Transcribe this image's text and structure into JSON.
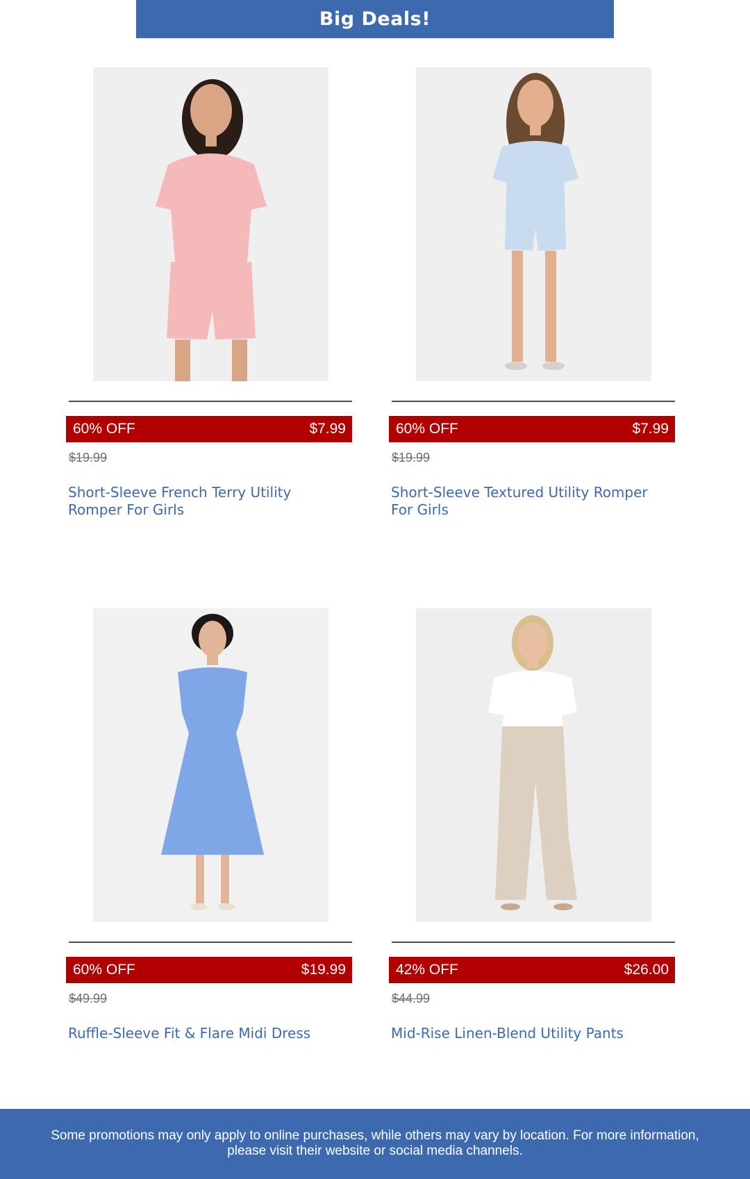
{
  "header": {
    "title": "Big Deals!"
  },
  "products": [
    {
      "discount": "60% OFF",
      "sale_price": "$7.99",
      "original_price": "$19.99",
      "name": "Short-Sleeve French Terry Utility Romper For Girls",
      "image_icon": "product-photo-pink-romper",
      "garment_color": "#f4b9b8"
    },
    {
      "discount": "60% OFF",
      "sale_price": "$7.99",
      "original_price": "$19.99",
      "name": "Short-Sleeve Textured Utility Romper For Girls",
      "image_icon": "product-photo-blue-romper",
      "garment_color": "#c9dcef"
    },
    {
      "discount": "60% OFF",
      "sale_price": "$19.99",
      "original_price": "$49.99",
      "name": "Ruffle-Sleeve Fit & Flare Midi Dress",
      "image_icon": "product-photo-blue-dress",
      "garment_color": "#7fa6e6"
    },
    {
      "discount": "42% OFF",
      "sale_price": "$26.00",
      "original_price": "$44.99",
      "name": "Mid-Rise Linen-Blend Utility Pants",
      "image_icon": "product-photo-linen-pants",
      "garment_color": "#ddd0c0"
    }
  ],
  "footer": {
    "disclaimer": "Some promotions may only apply to online purchases, while others may vary by location. For more information, please visit their website or social media channels."
  },
  "colors": {
    "brand_blue": "#3d6aaf",
    "sale_red": "#b20000",
    "strike_gray": "#6e6e6e"
  }
}
